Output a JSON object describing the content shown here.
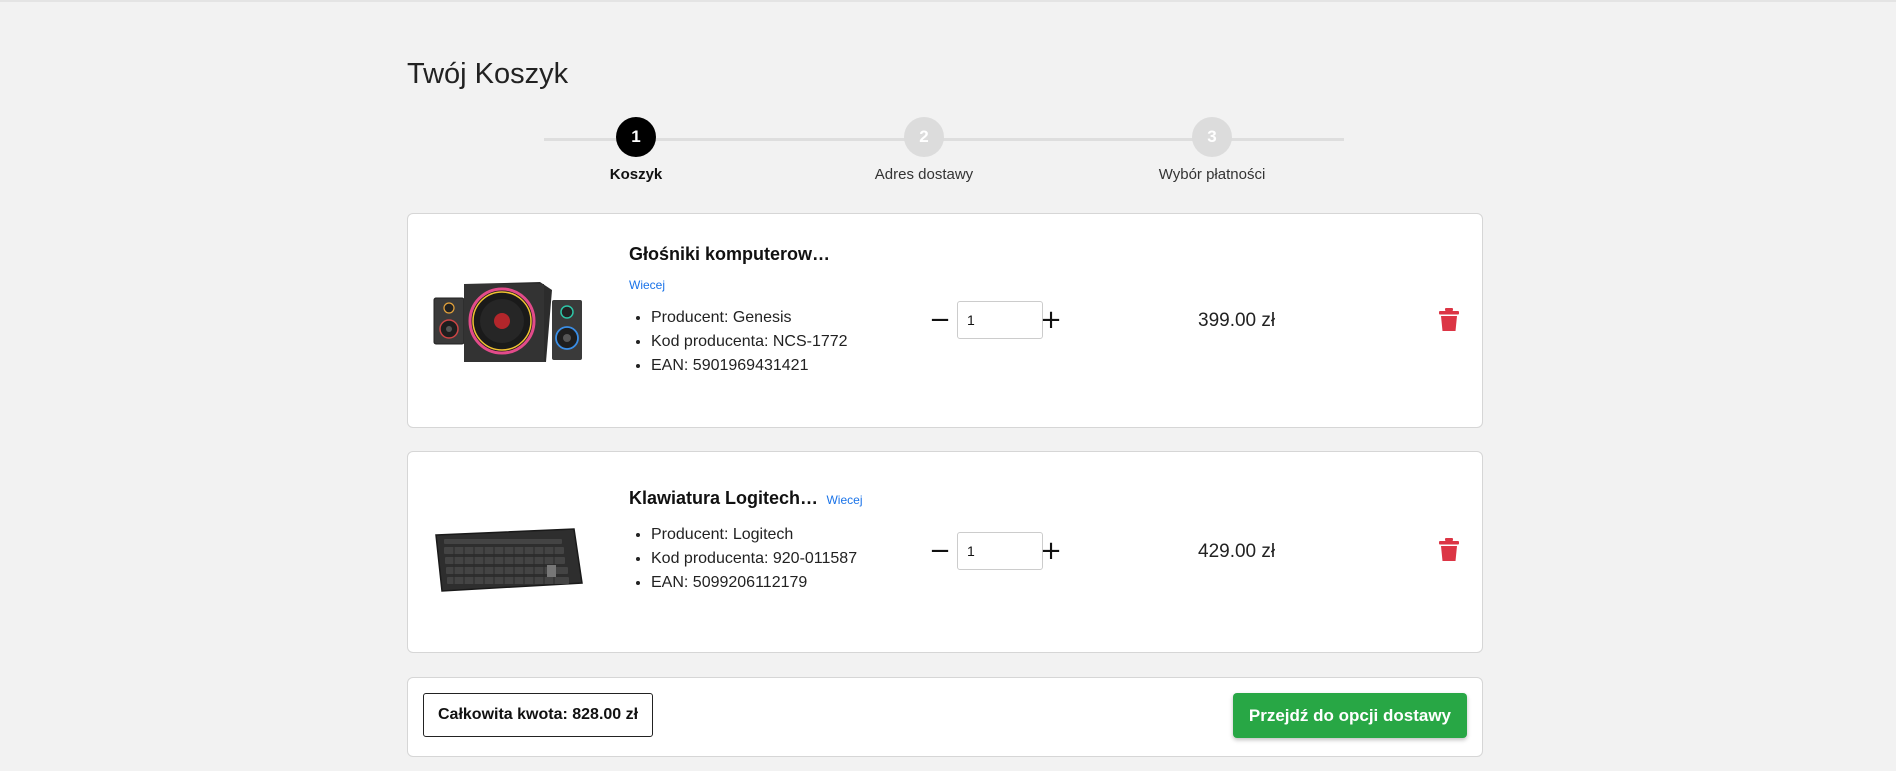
{
  "page": {
    "title": "Twój Koszyk"
  },
  "stepper": {
    "steps": [
      {
        "number": "1",
        "label": "Koszyk",
        "active": true
      },
      {
        "number": "2",
        "label": "Adres dostawy",
        "active": false
      },
      {
        "number": "3",
        "label": "Wybór płatności",
        "active": false
      }
    ]
  },
  "cart": {
    "items": [
      {
        "name": "Głośniki komputerow…",
        "more_label": "Wiecej",
        "image": "computer-speakers-image",
        "specs": [
          "Producent: Genesis",
          "Kod producenta: NCS-1772",
          "EAN: 5901969431421"
        ],
        "quantity": "1",
        "price": "399.00 zł"
      },
      {
        "name": "Klawiatura Logitech…",
        "more_label": "Wiecej",
        "image": "keyboard-image",
        "specs": [
          "Producent: Logitech",
          "Kod producenta: 920-011587",
          "EAN: 5099206112179"
        ],
        "quantity": "1",
        "price": "429.00 zł"
      }
    ],
    "qty_minus": "−",
    "qty_plus": "+"
  },
  "summary": {
    "total_label": "Całkowita kwota: 828.00 zł",
    "checkout_label": "Przejdź do opcji dostawy"
  },
  "colors": {
    "background": "#f2f2f2",
    "accent_green": "#28a745",
    "delete_red": "#dc3545",
    "link_blue": "#1a73e8",
    "step_active": "#000000",
    "step_inactive": "#dcdcdc"
  }
}
